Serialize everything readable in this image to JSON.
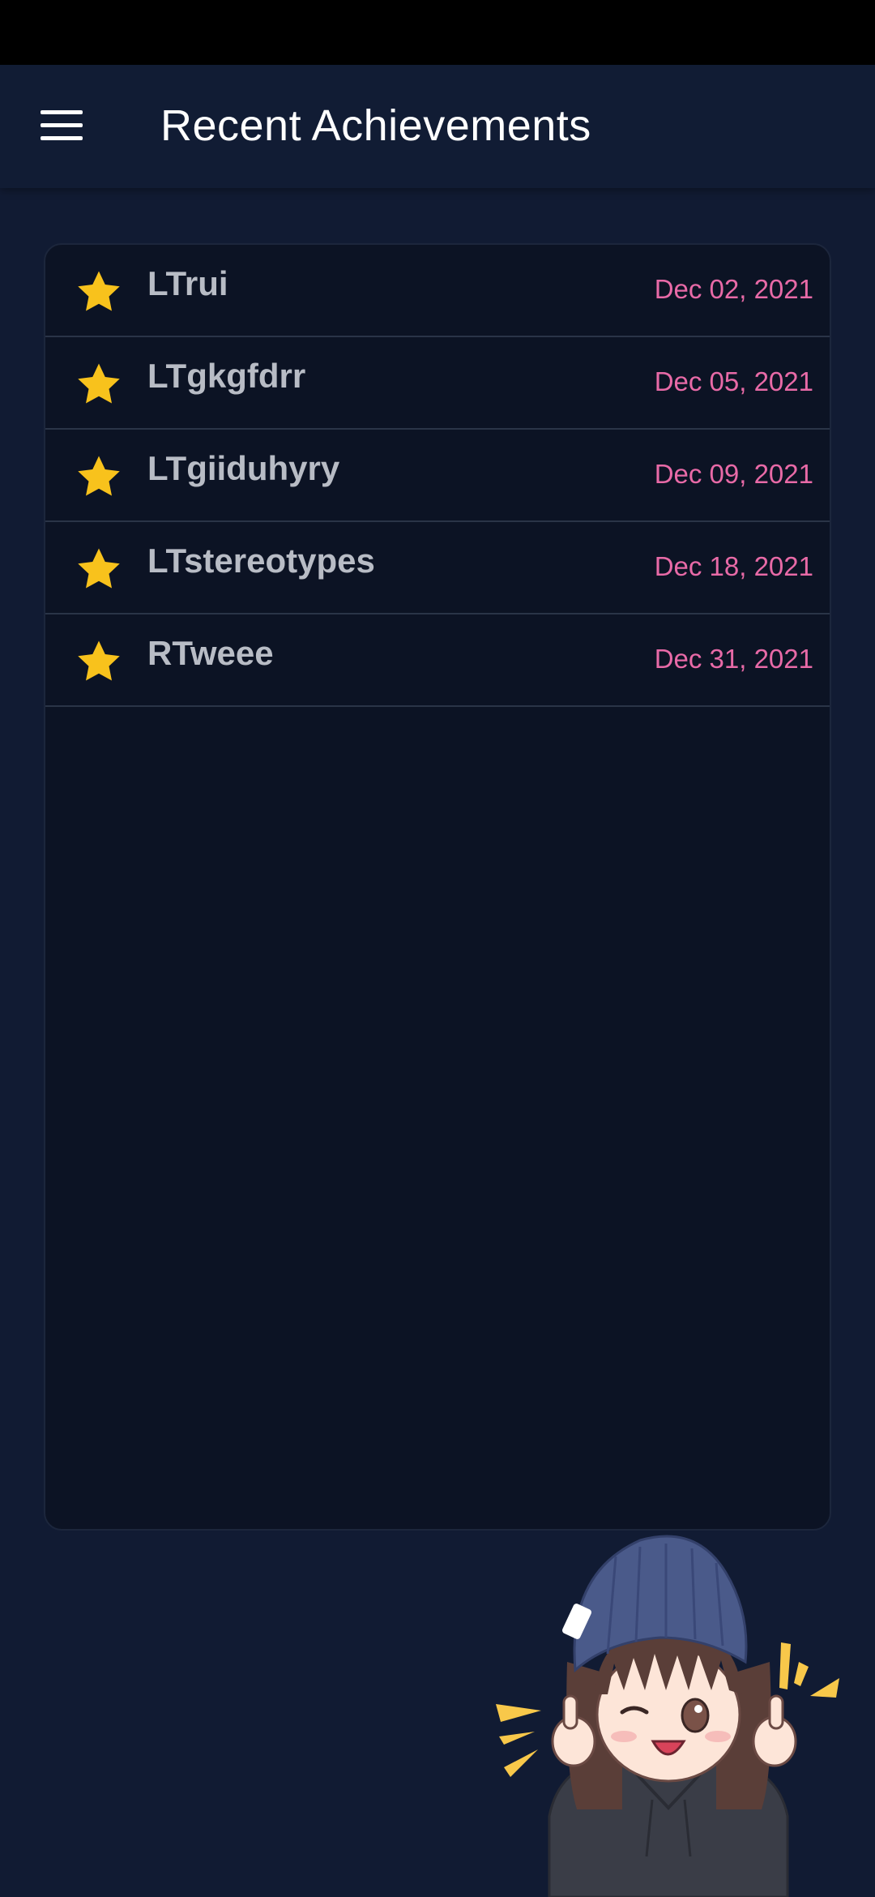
{
  "app_bar": {
    "title": "Recent Achievements",
    "menu_icon": "hamburger-menu-icon"
  },
  "achievements": [
    {
      "name": "LTrui",
      "date": "Dec 02, 2021",
      "icon": "star-icon"
    },
    {
      "name": "LTgkgfdrr",
      "date": "Dec 05, 2021",
      "icon": "star-icon"
    },
    {
      "name": "LTgiiduhyry",
      "date": "Dec 09, 2021",
      "icon": "star-icon"
    },
    {
      "name": "LTstereotypes",
      "date": "Dec 18, 2021",
      "icon": "star-icon"
    },
    {
      "name": "RTweee",
      "date": "Dec 31, 2021",
      "icon": "star-icon"
    }
  ],
  "colors": {
    "background": "#111b33",
    "panel": "#0c1324",
    "star": "#f8c21c",
    "date": "#e86aa7",
    "name": "#b8bcc5"
  }
}
